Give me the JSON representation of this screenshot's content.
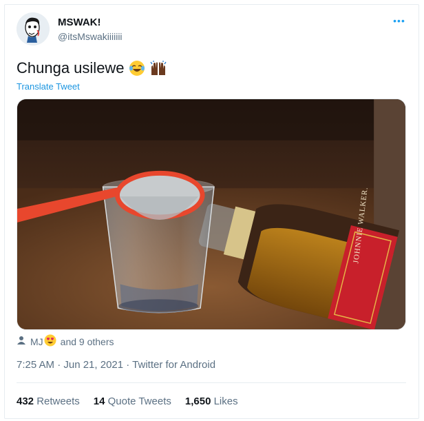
{
  "user": {
    "display_name": "MSWAK!",
    "handle": "@itsMswakiiiiiii"
  },
  "tweet": {
    "text": "Chunga usilewe",
    "emojis": [
      "face-with-tears-of-joy",
      "raising-hands-dark-skin"
    ],
    "translate_label": "Translate Tweet"
  },
  "photo": {
    "bottle_label": "JOHNNIE WALKER."
  },
  "likers": {
    "first_name": "MJ",
    "emoji": "heart-eyes",
    "rest": "and 9 others"
  },
  "meta": {
    "timestamp": "7:25 AM · Jun 21, 2021 · Twitter for Android"
  },
  "stats": {
    "retweets_count": "432",
    "retweets_label": "Retweets",
    "quotes_count": "14",
    "quotes_label": "Quote Tweets",
    "likes_count": "1,650",
    "likes_label": "Likes"
  },
  "colors": {
    "link": "#1b95e0",
    "secondary": "#5b7083",
    "label_red": "#c8202b"
  }
}
